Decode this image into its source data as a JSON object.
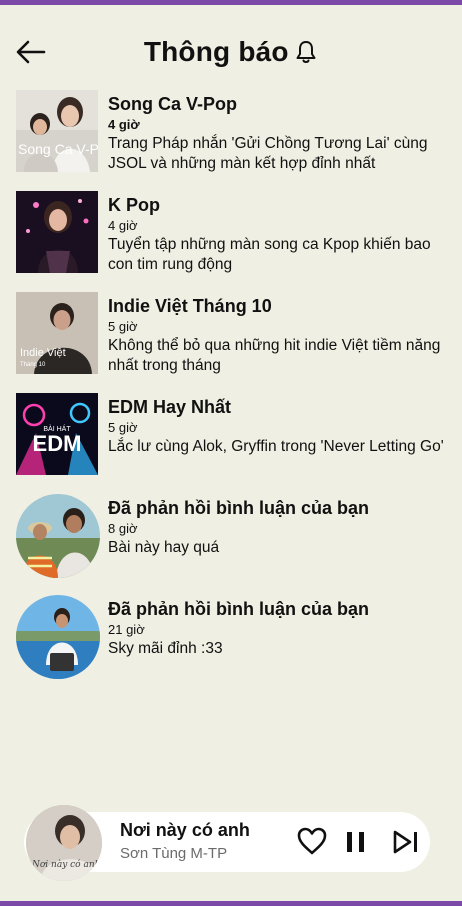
{
  "header": {
    "title": "Thông báo"
  },
  "notifications": [
    {
      "title": "Song Ca V-Pop",
      "time": "4 giờ",
      "description": "Trang Pháp nhắn 'Gửi Chồng Tương Lai' cùng JSOL và những màn kết hợp đỉnh nhất",
      "cover_text": "Song Ca V-Pop"
    },
    {
      "title": "K Pop",
      "time": "4 giờ",
      "description": "Tuyển tập những màn song ca Kpop khiến bao con tim rung động"
    },
    {
      "title": "Indie Việt Tháng 10",
      "time": "5 giờ",
      "description": "Không thể bỏ qua những hit indie Việt tiềm năng nhất trong tháng",
      "cover_text": "Indie Việt",
      "cover_subtext": "Tháng 10"
    },
    {
      "title": "EDM Hay Nhất",
      "time": "5 giờ",
      "description": "Lắc lư cùng Alok, Gryffin trong 'Never Letting Go'",
      "cover_text": "EDM",
      "cover_subtext": "BÀI HÁT"
    },
    {
      "title": "Đã phản hồi bình luận của bạn",
      "time": "8 giờ",
      "description": "Bài này hay quá"
    },
    {
      "title": "Đã phản hồi bình luận của bạn",
      "time": "21 giờ",
      "description": "Sky mãi đỉnh :33"
    }
  ],
  "player": {
    "song": "Nơi này có anh",
    "artist": "Sơn Tùng M-TP",
    "cover_text": "Nơi này có anh"
  },
  "colors": {
    "accent": "#7b4aa8",
    "background": "#efefe3"
  }
}
